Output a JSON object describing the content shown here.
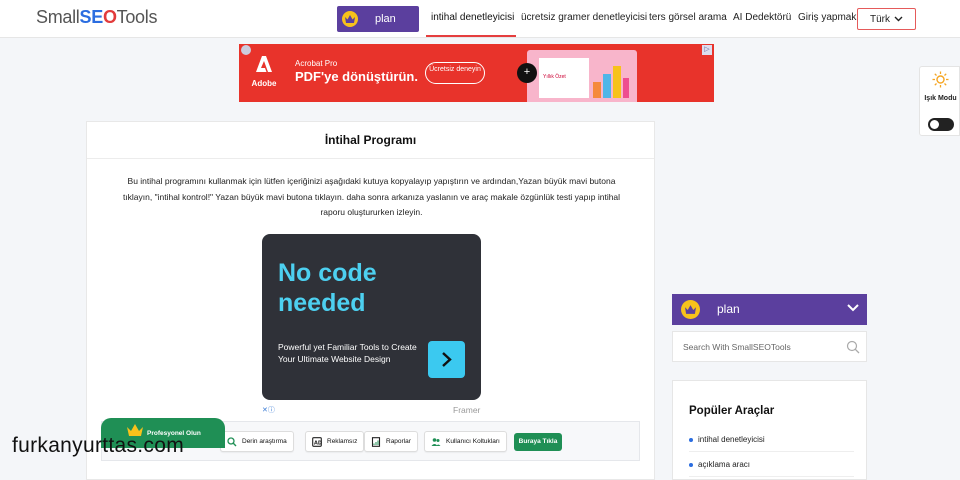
{
  "header": {
    "logo": {
      "part1": "Small",
      "part2": "SE",
      "part3": "O",
      "part4": "Tools"
    },
    "plan_label": "plan",
    "nav": [
      {
        "label": "intihal denetleyicisi",
        "active": true
      },
      {
        "label": "ücretsiz gramer denetleyicisi"
      },
      {
        "label": "ters görsel arama"
      },
      {
        "label": "AI Dedektörü"
      },
      {
        "label": "Giriş yapmak"
      }
    ],
    "language": "Türk"
  },
  "ad_banner": {
    "brand": "Adobe",
    "subtitle": "Acrobat Pro",
    "headline": "PDF'ye dönüştürün.",
    "cta": "Ücretsiz deneyin",
    "doc_text": "Yıllık Özet"
  },
  "main": {
    "title": "İntihal Programı",
    "description": "Bu intihal programını kullanmak için lütfen içeriğinizi aşağıdaki kutuya kopyalayıp yapıştırın ve ardından,Yazan büyük mavi butona tıklayın, \"intihal kontrol!\" Yazan büyük mavi butona tıklayın. daha sonra arkanıza yaslanın ve araç makale özgünlük testi yapıp intihal raporu oluştururken izleyin.",
    "inner_ad": {
      "headline": "No code needed",
      "body": "Powerful yet Familiar Tools to Create Your Ultimate Website Design",
      "sponsor": "Framer"
    },
    "pro_tab": "Profesyonel Olun",
    "toolbar": [
      {
        "label": "Derin araştırma",
        "icon": "search-icon"
      },
      {
        "label": "Reklamsız",
        "icon": "ad-block-icon"
      },
      {
        "label": "Raporlar",
        "icon": "report-icon"
      },
      {
        "label": "Kullanıcı Koltukları",
        "icon": "users-icon"
      }
    ],
    "toolbar_cta": "Buraya Tıkla"
  },
  "mode_widget": {
    "label": "Işık Modu"
  },
  "sidebar": {
    "plan_label": "plan",
    "search_placeholder": "Search With SmallSEOTools",
    "popular_title": "Popüler Araçlar",
    "popular_items": [
      "intihal denetleyicisi",
      "açıklama aracı"
    ]
  },
  "watermark": "furkanyurttas.com",
  "colors": {
    "plan_purple": "#5b3f9e",
    "crown_yellow": "#f7c21b",
    "accent_red": "#e53e3e",
    "cta_green": "#1f8f55",
    "ad_red": "#e8332b",
    "inner_ad_cyan": "#4dd0f0"
  }
}
